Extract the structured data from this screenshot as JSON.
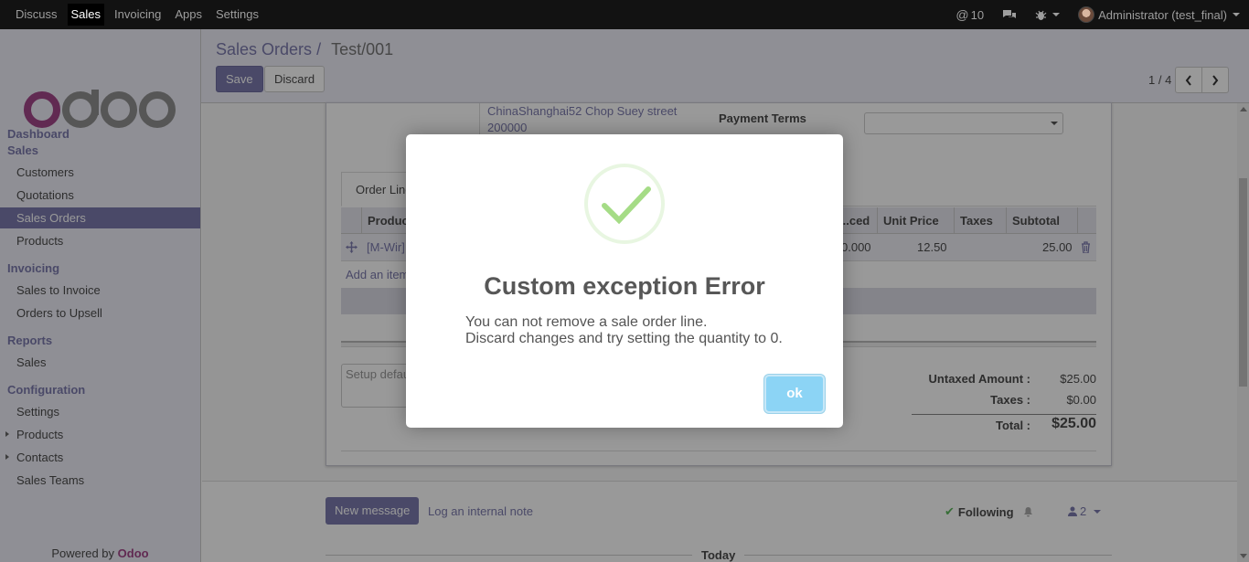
{
  "topbar": {
    "menu": [
      "Discuss",
      "Sales",
      "Invoicing",
      "Apps",
      "Settings"
    ],
    "active": "Sales",
    "mentions_count": "10",
    "user": "Administrator (test_final)"
  },
  "sidebar": {
    "sections": [
      {
        "title": "Dashboard",
        "items": []
      },
      {
        "title": "Sales",
        "items": [
          "Customers",
          "Quotations",
          "Sales Orders",
          "Products"
        ]
      },
      {
        "title": "Invoicing",
        "items": [
          "Sales to Invoice",
          "Orders to Upsell"
        ]
      },
      {
        "title": "Reports",
        "items": [
          "Sales"
        ]
      },
      {
        "title": "Configuration",
        "items": [
          "Settings",
          "Products",
          "Contacts",
          "Sales Teams"
        ]
      }
    ],
    "active_item": "Sales Orders",
    "powered_by": "Powered by",
    "powered_brand": "Odoo"
  },
  "control_panel": {
    "breadcrumb_parent": "Sales Orders",
    "breadcrumb_sep": "/",
    "breadcrumb_current": "Test/001",
    "save_label": "Save",
    "discard_label": "Discard",
    "pager": "1 / 4"
  },
  "form": {
    "address_line1": "ChinaShanghai52 Chop Suey street",
    "address_line2": "200000",
    "payment_terms_label": "Payment Terms",
    "tab_order_lines": "Order Lines",
    "columns": [
      "Product",
      "...ced",
      "Unit Price",
      "Taxes",
      "Subtotal"
    ],
    "row": {
      "product": "[M-Wir]",
      "invoiced": "0.000",
      "unit_price": "12.50",
      "taxes": "",
      "subtotal": "25.00"
    },
    "add_item": "Add an item",
    "notes_placeholder": "Setup default terms and conditions",
    "untaxed_label": "Untaxed Amount :",
    "untaxed_value": "$25.00",
    "taxes_label": "Taxes :",
    "taxes_value": "$0.00",
    "total_label": "Total :",
    "total_value": "$25.00"
  },
  "chatter": {
    "new_message": "New message",
    "log_note": "Log an internal note",
    "following": "Following",
    "followers": "2",
    "today": "Today"
  },
  "modal": {
    "title": "Custom exception Error",
    "line1": "You can not remove a sale order line.",
    "line2": "Discard changes and try setting the quantity to 0.",
    "ok_label": "ok",
    "check_color": "#a5dc86",
    "ok_color": "#8cd4f5"
  }
}
